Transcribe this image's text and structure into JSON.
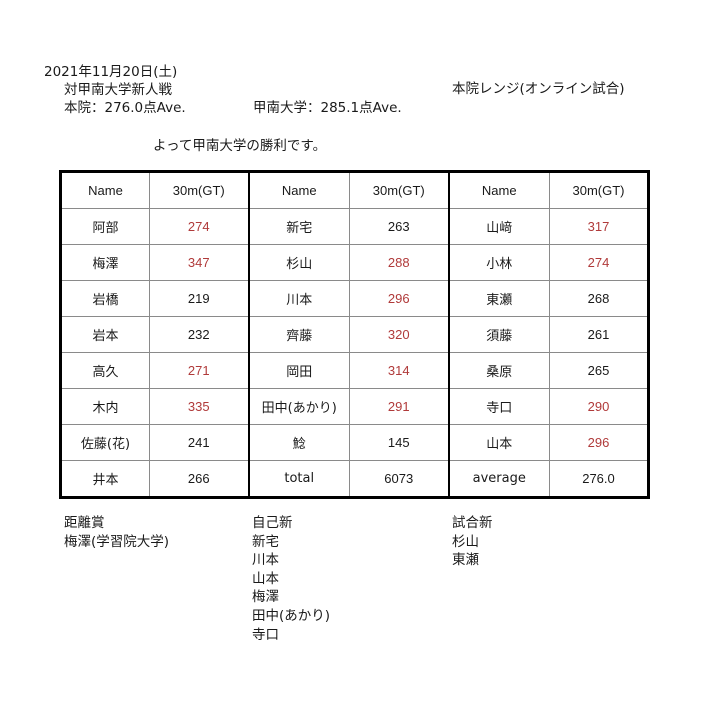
{
  "header": {
    "date": "2021年11月20日(土)",
    "match_title": "対甲南大学新人戦",
    "venue": "本院レンジ(オンライン試合)",
    "home_avg": "本院：276.0点Ave.",
    "opponent_avg": "甲南大学：285.1点Ave.",
    "result": "よって甲南大学の勝利です。"
  },
  "table": {
    "headers": [
      "Name",
      "30m(GT)",
      "Name",
      "30m(GT)",
      "Name",
      "30m(GT)"
    ],
    "rows": [
      [
        {
          "name": "阿部",
          "score": "274",
          "red": true
        },
        {
          "name": "新宅",
          "score": "263",
          "red": false
        },
        {
          "name": "山﨑",
          "score": "317",
          "red": true
        }
      ],
      [
        {
          "name": "梅澤",
          "score": "347",
          "red": true
        },
        {
          "name": "杉山",
          "score": "288",
          "red": true
        },
        {
          "name": "小林",
          "score": "274",
          "red": true
        }
      ],
      [
        {
          "name": "岩橋",
          "score": "219",
          "red": false
        },
        {
          "name": "川本",
          "score": "296",
          "red": true
        },
        {
          "name": "東瀬",
          "score": "268",
          "red": false
        }
      ],
      [
        {
          "name": "岩本",
          "score": "232",
          "red": false
        },
        {
          "name": "齊藤",
          "score": "320",
          "red": true
        },
        {
          "name": "須藤",
          "score": "261",
          "red": false
        }
      ],
      [
        {
          "name": "高久",
          "score": "271",
          "red": true
        },
        {
          "name": "岡田",
          "score": "314",
          "red": true
        },
        {
          "name": "桑原",
          "score": "265",
          "red": false
        }
      ],
      [
        {
          "name": "木内",
          "score": "335",
          "red": true
        },
        {
          "name": "田中(あかり)",
          "score": "291",
          "red": true
        },
        {
          "name": "寺口",
          "score": "290",
          "red": true
        }
      ],
      [
        {
          "name": "佐藤(花)",
          "score": "241",
          "red": false
        },
        {
          "name": "鯰",
          "score": "145",
          "red": false
        },
        {
          "name": "山本",
          "score": "296",
          "red": true
        }
      ],
      [
        {
          "name": "井本",
          "score": "266",
          "red": false
        },
        {
          "name": "total",
          "score": "6073",
          "red": false
        },
        {
          "name": "average",
          "score": "276.0",
          "red": false
        }
      ]
    ]
  },
  "awards": {
    "distance_award": [
      "距離賞",
      "梅澤(学習院大学)"
    ],
    "personal_best": [
      "自己新",
      "新宅",
      "川本",
      "山本",
      "梅澤",
      "田中(あかり)",
      "寺口"
    ],
    "match_record": [
      "試合新",
      "杉山",
      "東瀬"
    ]
  },
  "colors": {
    "highlight": "#b03a3a",
    "text": "#1a1a1a",
    "border": "#000000"
  }
}
